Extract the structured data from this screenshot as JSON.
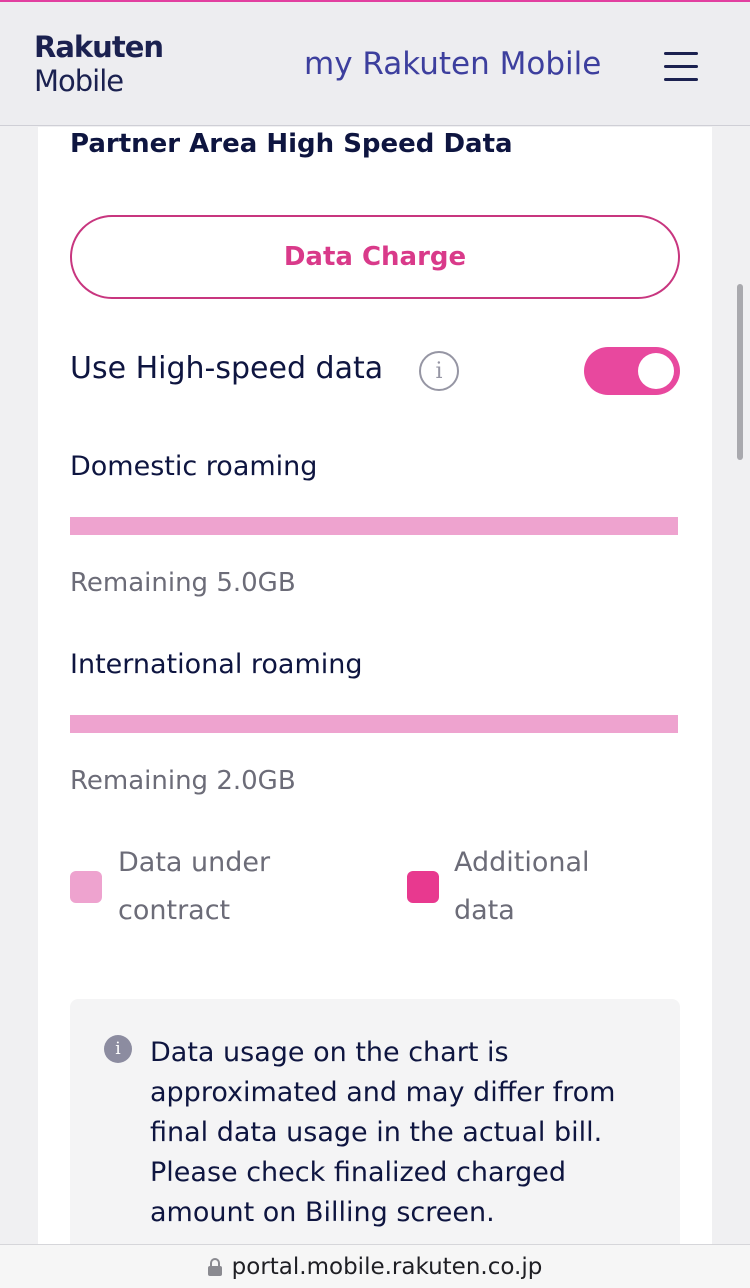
{
  "header": {
    "logo_line1": "Rakuten",
    "logo_line2": "Mobile",
    "title": "my Rakuten Mobile",
    "menu_icon": "hamburger-menu-icon"
  },
  "section": {
    "title": "Partner Area High Speed Data",
    "charge_button": "Data Charge",
    "toggle_label": "Use High-speed data",
    "toggle_on": true,
    "info_glyph": "i"
  },
  "domestic": {
    "label": "Domestic roaming",
    "remaining": "Remaining 5.0GB",
    "remaining_fraction": 1.0
  },
  "international": {
    "label": "International roaming",
    "remaining": "Remaining 2.0GB",
    "remaining_fraction": 1.0
  },
  "legend": {
    "contract_line1": "Data under",
    "contract_line2": "contract",
    "contract_color": "#eea3cf",
    "additional_line1": "Additional",
    "additional_line2": "data",
    "additional_color": "#e8398f"
  },
  "notice": {
    "glyph": "i",
    "text": "Data usage on the chart is approximated and may differ from final data usage in the actual bill. Please check finalized charged amount on Billing screen."
  },
  "browser": {
    "url": "portal.mobile.rakuten.co.jp"
  },
  "colors": {
    "accent": "#e8489e",
    "brand_navy": "#1b2150"
  }
}
